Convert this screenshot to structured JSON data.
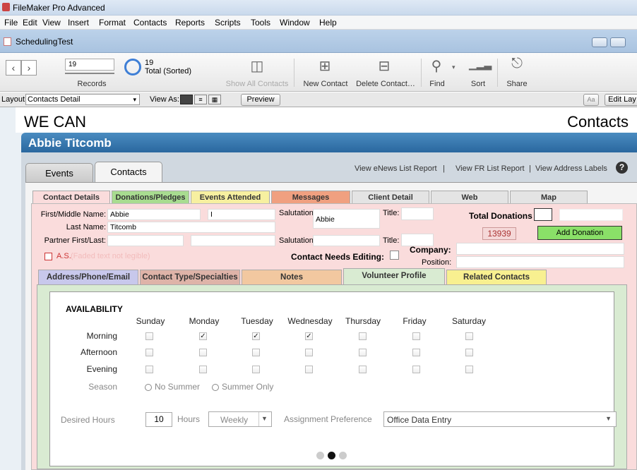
{
  "app_title": "FileMaker Pro Advanced",
  "menu": [
    "File",
    "Edit",
    "View",
    "Insert",
    "Format",
    "Contacts",
    "Reports",
    "Scripts",
    "Tools",
    "Window",
    "Help"
  ],
  "window_title": "SchedulingTest",
  "toolbar": {
    "record_field": "19",
    "records_label": "Records",
    "found_count": "19",
    "total_label": "Total (Sorted)",
    "show_all": "Show All Contacts",
    "new_contact": "New Contact",
    "delete_contact": "Delete Contact…",
    "find": "Find",
    "sort": "Sort",
    "share": "Share"
  },
  "layoutbar": {
    "layout_label": "Layout:",
    "layout_value": "Contacts Detail",
    "view_as": "View As:",
    "preview": "Preview",
    "aa": "Aa",
    "edit_layout": "Edit Lay"
  },
  "header": {
    "org": "WE CAN",
    "section": "Contacts",
    "contact_name": "Abbie Titcomb"
  },
  "main_tabs": {
    "events": "Events",
    "contacts": "Contacts"
  },
  "links": {
    "enews": "View eNews List Report",
    "fr": "View FR List Report",
    "labels": "View Address Labels",
    "sep": "|"
  },
  "sub_tabs": [
    "Contact Details",
    "Donations/Pledges",
    "Events Attended",
    "Messages",
    "Client Detail",
    "Web",
    "Map"
  ],
  "form": {
    "first_middle_label": "First/Middle Name:",
    "first": "Abbie",
    "middle": "I",
    "last_label": "Last Name:",
    "last": "Titcomb",
    "partner_label": "Partner First/Last:",
    "salutation_label": "Salutation:",
    "salutation": "Abbie",
    "salutation2_label": "Salutation:",
    "title_label": "Title:",
    "title2_label": "Title:",
    "total_donations_label": "Total Donations",
    "id": "13939",
    "add_donation": "Add Donation",
    "as_label": "A.S.",
    "as_extra": "(Faded text not legible)",
    "needs_editing": "Contact Needs Editing:",
    "company_label": "Company:",
    "position_label": "Position:"
  },
  "inner_tabs": [
    "Address/Phone/Email",
    "Contact Type/Specialties",
    "Notes",
    "Volunteer Profile",
    "Related Contacts"
  ],
  "availability": {
    "title": "AVAILABILITY",
    "days": [
      "Sunday",
      "Monday",
      "Tuesday",
      "Wednesday",
      "Thursday",
      "Friday",
      "Saturday"
    ],
    "rows": [
      {
        "label": "Morning",
        "checked": [
          false,
          true,
          true,
          true,
          false,
          false,
          false
        ]
      },
      {
        "label": "Afternoon",
        "checked": [
          false,
          false,
          false,
          false,
          false,
          false,
          false
        ]
      },
      {
        "label": "Evening",
        "checked": [
          false,
          false,
          false,
          false,
          false,
          false,
          false
        ]
      }
    ],
    "season_label": "Season",
    "season_opt1": "No Summer",
    "season_opt2": "Summer Only",
    "desired_hours_label": "Desired Hours",
    "desired_hours": "10",
    "hours_label": "Hours",
    "frequency": "Weekly",
    "assignment_label": "Assignment Preference",
    "assignment": "Office Data Entry"
  }
}
